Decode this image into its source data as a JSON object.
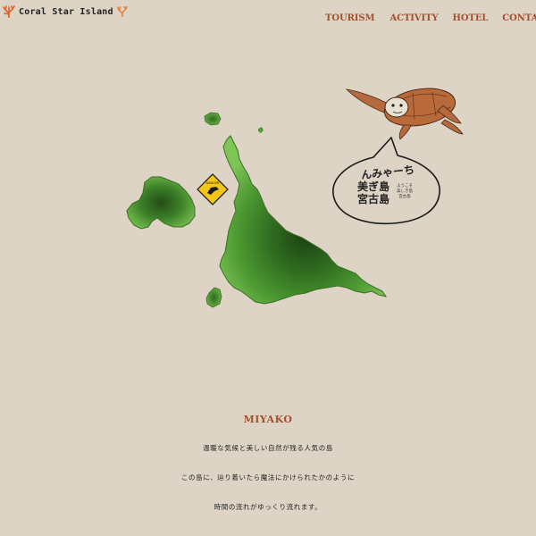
{
  "header": {
    "logo_text": "Coral Star Island"
  },
  "nav": {
    "items": [
      "TOURISM",
      "ACTIVITY",
      "HOTEL",
      "CONTACT"
    ]
  },
  "map": {
    "speech_bubble": {
      "line1": "んみゃーち",
      "line2": "美ぎ島",
      "line3": "宮古島",
      "small_text": "ようこそ 美しき島 宮古島"
    },
    "sign_label": "DANGER",
    "colors": {
      "land_dark": "#1f4a14",
      "land_mid": "#3f8a2a",
      "land_light": "#6fb84a",
      "sign_yellow": "#f3c619"
    }
  },
  "section": {
    "title": "MIYAKO",
    "lines": [
      "温暖な気候と美しい自然が残る人気の島",
      "この島に、辿り着いたら魔法にかけられたかのように",
      "時間の流れがゆっくり流れます。"
    ]
  },
  "colors": {
    "background": "#ddd4c5",
    "accent": "#a2502e"
  }
}
